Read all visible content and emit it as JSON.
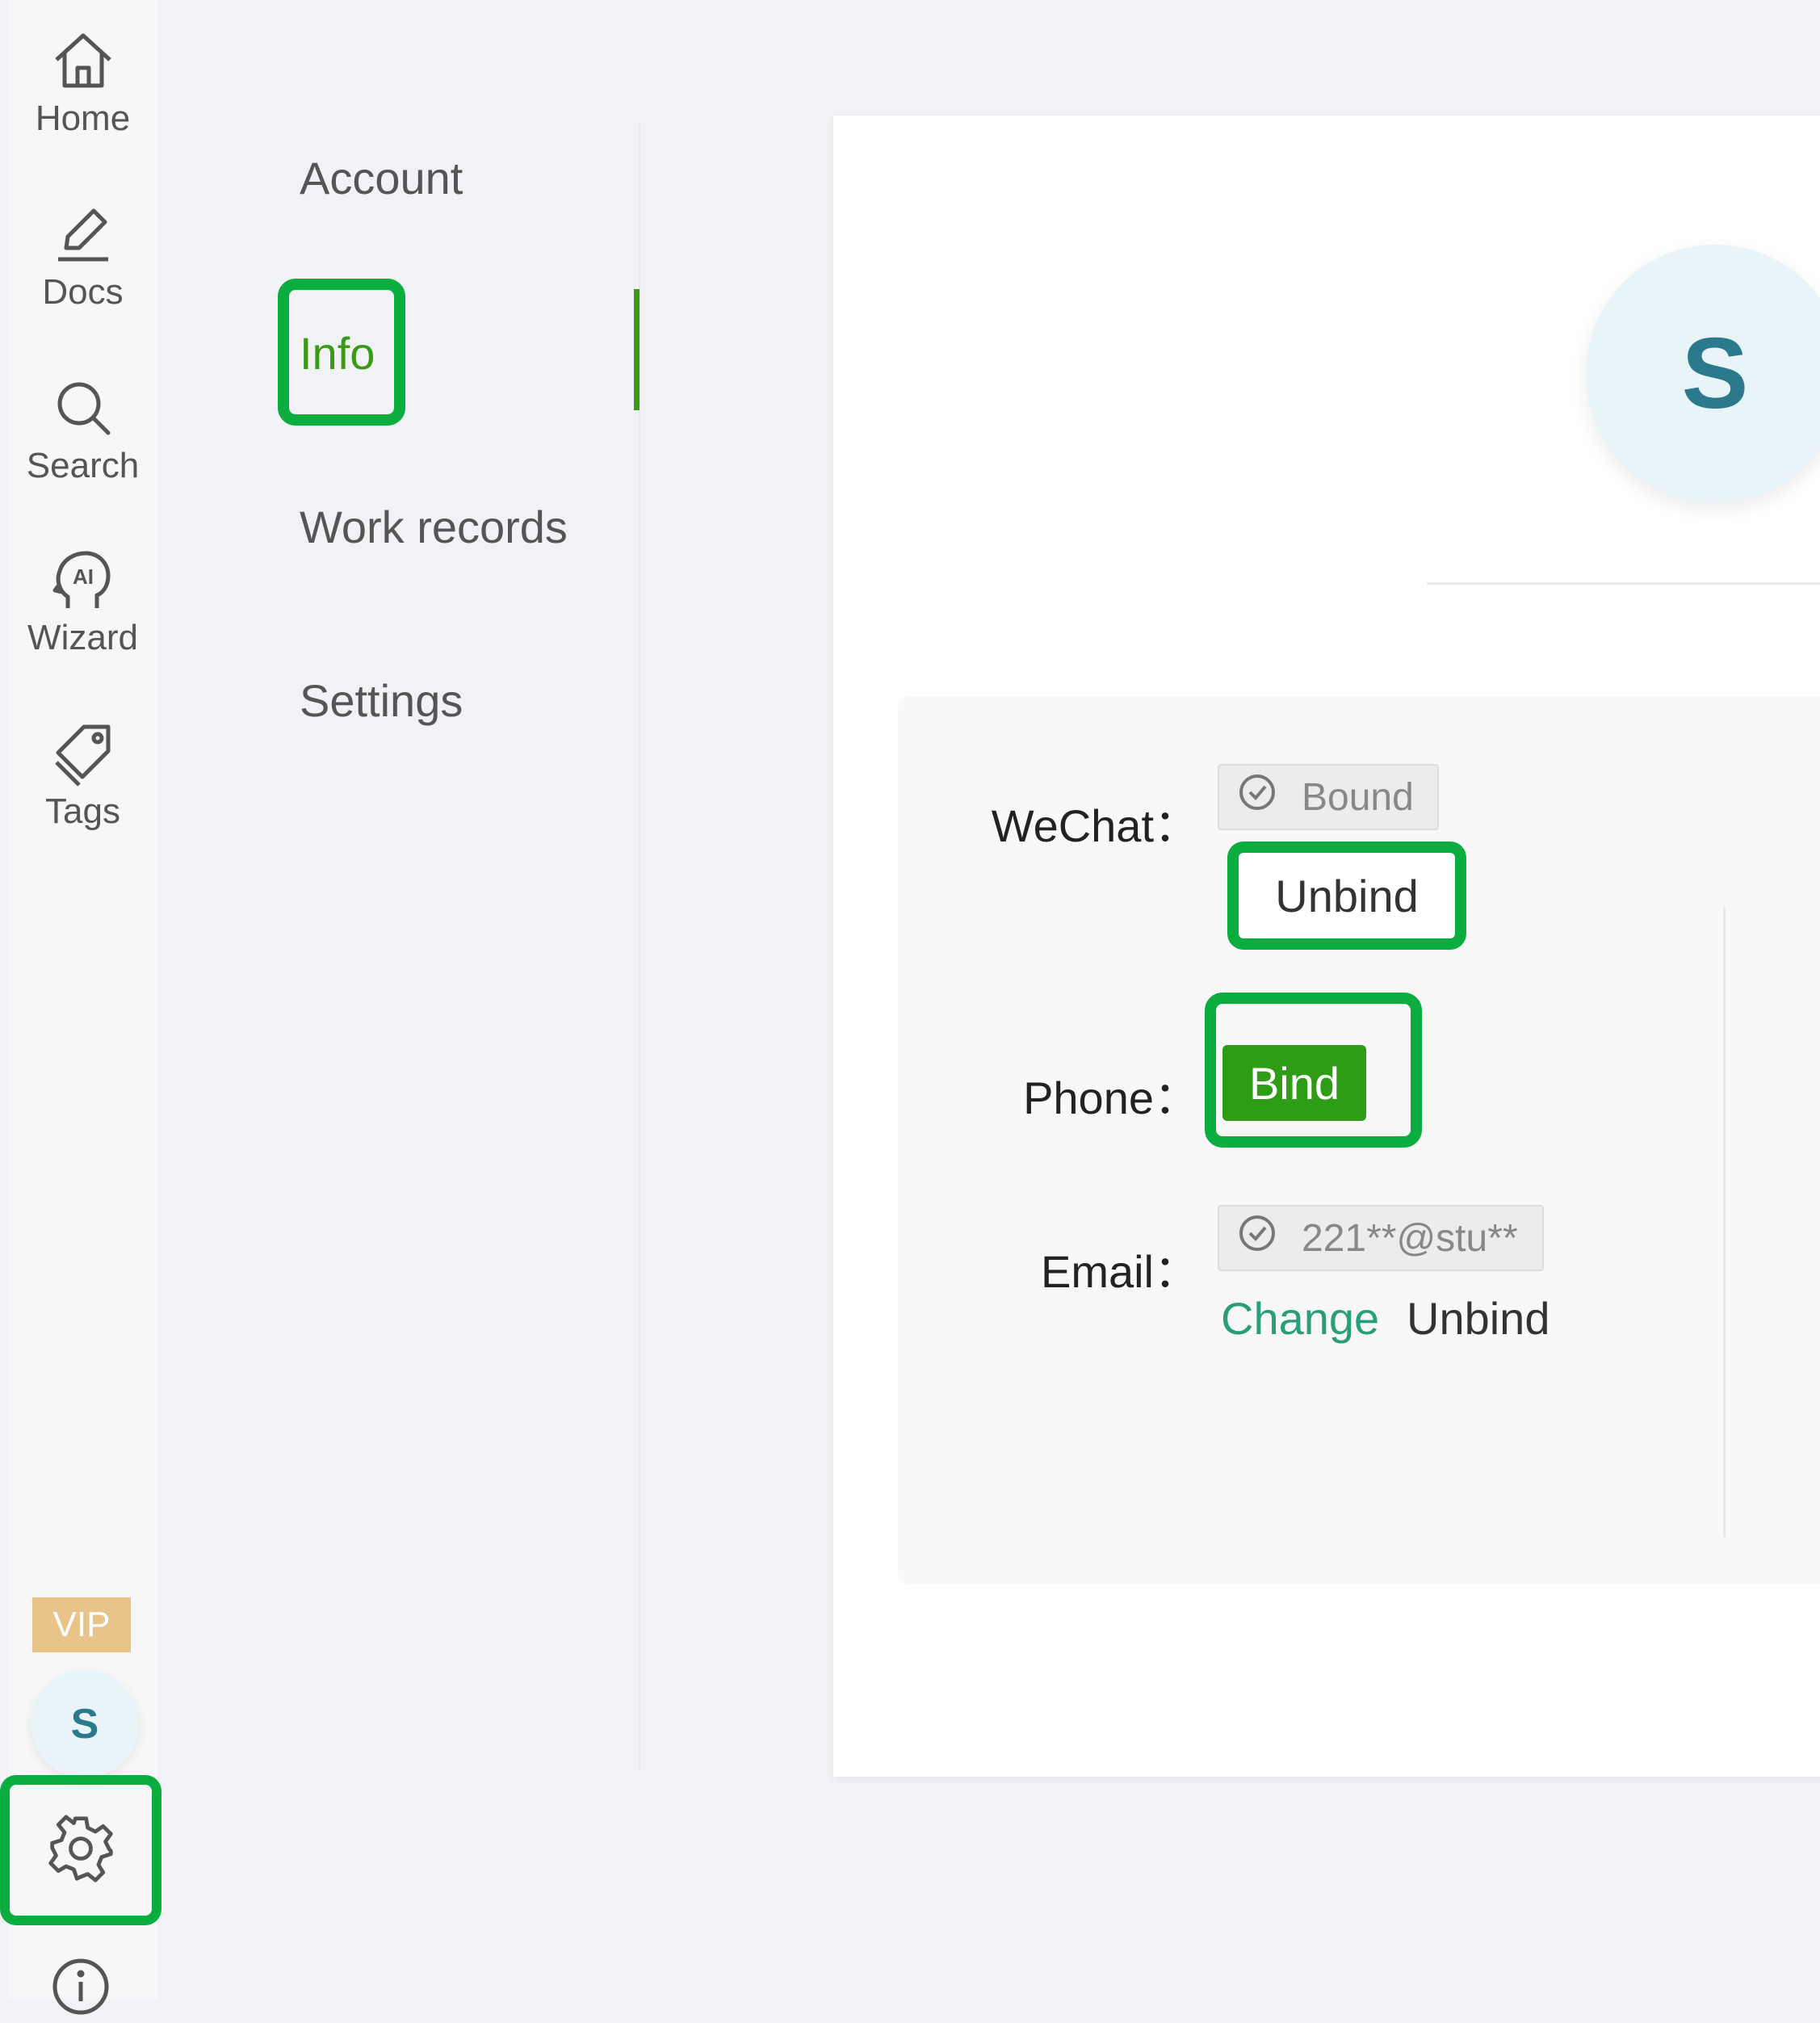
{
  "sidebar": {
    "items": [
      {
        "label": "Home",
        "icon": "home-icon"
      },
      {
        "label": "Docs",
        "icon": "pen-icon"
      },
      {
        "label": "Search",
        "icon": "search-icon"
      },
      {
        "label": "Wizard",
        "icon": "ai-head-icon"
      },
      {
        "label": "Tags",
        "icon": "tag-icon"
      }
    ],
    "vip_badge": "VIP",
    "avatar_letter": "S"
  },
  "subnav": {
    "items": [
      "Account",
      "Info",
      "Work records",
      "Settings"
    ],
    "active": "Info"
  },
  "profile": {
    "avatar_letter": "S"
  },
  "bindings": {
    "wechat": {
      "label": "WeChat",
      "status": "Bound",
      "action": "Unbind"
    },
    "phone": {
      "label": "Phone",
      "action": "Bind"
    },
    "email": {
      "label": "Email",
      "value": "221**@stu**",
      "change": "Change",
      "unbind": "Unbind"
    }
  },
  "colors": {
    "accent_green": "#3a9a17",
    "highlight_green": "#0cad3f",
    "link_teal": "#2a9d7a",
    "vip_gold": "#e9c48a"
  }
}
